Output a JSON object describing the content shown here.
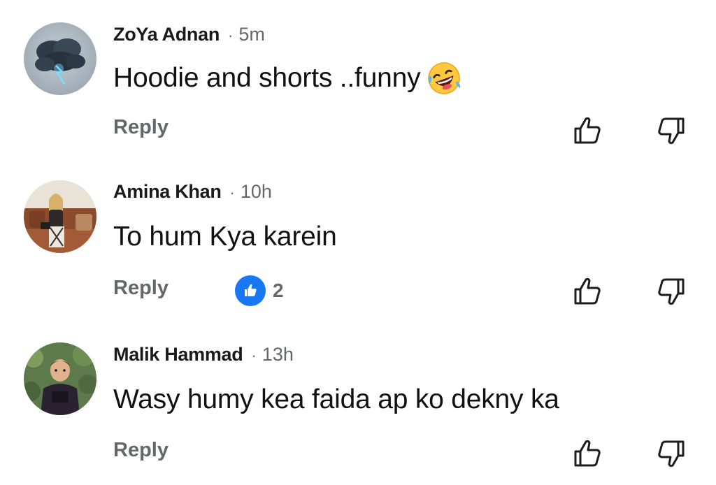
{
  "comments": [
    {
      "author": "ZoYa Adnan",
      "separator": "·",
      "time": "5m",
      "text": "Hoodie and shorts ..funny",
      "emoji": "rolling-on-floor-laughing",
      "reply_label": "Reply",
      "reaction_count": null
    },
    {
      "author": "Amina Khan",
      "separator": "·",
      "time": "10h",
      "text": "To hum Kya karein",
      "emoji": null,
      "reply_label": "Reply",
      "reaction_icon": "like-icon",
      "reaction_count": "2"
    },
    {
      "author": "Malik Hammad",
      "separator": "·",
      "time": "13h",
      "text": "Wasy humy kea faida ap ko dekny ka",
      "emoji": null,
      "reply_label": "Reply",
      "reaction_count": null
    }
  ],
  "colors": {
    "secondary_text": "#65676b",
    "like_badge": "#1877f2"
  }
}
